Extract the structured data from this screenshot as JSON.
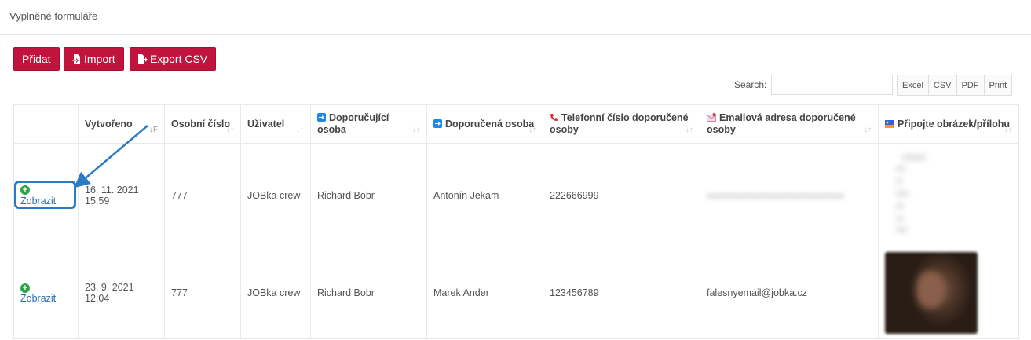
{
  "page": {
    "title": "Vyplněné formuláře"
  },
  "toolbar": {
    "add_label": "Přidat",
    "import_label": "Import",
    "export_label": "Export CSV"
  },
  "search": {
    "label": "Search:",
    "value": ""
  },
  "export_buttons": [
    "Excel",
    "CSV",
    "PDF",
    "Print"
  ],
  "table": {
    "headers": [
      {
        "text": ""
      },
      {
        "text": "Vytvořeno"
      },
      {
        "text": "Osobní číslo"
      },
      {
        "text": "Uživatel"
      },
      {
        "text": "Doporučující osoba",
        "icon": "arrow-right-icon"
      },
      {
        "text": "Doporučená osoba",
        "icon": "arrow-right-icon"
      },
      {
        "text": "Telefonní číslo doporučené osoby",
        "icon": "phone-icon"
      },
      {
        "text": "Emailová adresa doporučené osoby",
        "icon": "envelope-icon"
      },
      {
        "text": "Připojte obrázek/přílohu",
        "icon": "image-icon"
      }
    ],
    "rows": [
      {
        "action": "Zobrazit",
        "created_date": "16. 11. 2021",
        "created_time": "15:59",
        "personal_number": "777",
        "user": "JOBka crew",
        "referrer": "Richard Bobr",
        "referred": "Antonín Jekam",
        "phone": "222666999"
      },
      {
        "action": "Zobrazit",
        "created_date": "23. 9. 2021",
        "created_time": "12:04",
        "personal_number": "777",
        "user": "JOBka crew",
        "referrer": "Richard Bobr",
        "referred": "Marek Ander",
        "phone": "123456789",
        "email": "falesnyemail@jobka.cz"
      }
    ]
  },
  "colors": {
    "primary": "#c0143c",
    "link": "#2a6fb8",
    "plus": "#2ea54a",
    "callout": "#2b7bc2"
  }
}
